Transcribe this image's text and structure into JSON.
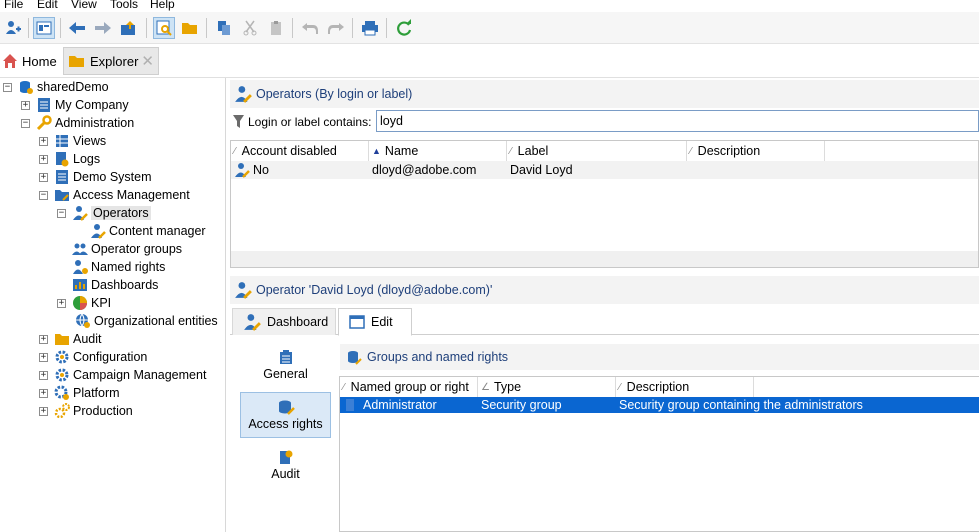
{
  "menu": [
    "File",
    "Edit",
    "View",
    "Tools",
    "Help"
  ],
  "tabs": {
    "home": "Home",
    "explorer": "Explorer"
  },
  "tree": {
    "root": "sharedDemo",
    "my_company": "My Company",
    "administration": "Administration",
    "views": "Views",
    "logs": "Logs",
    "demo_system": "Demo System",
    "access_management": "Access Management",
    "operators": "Operators",
    "content_manager": "Content manager",
    "operator_groups": "Operator groups",
    "named_rights": "Named rights",
    "dashboards": "Dashboards",
    "kpi": "KPI",
    "organizational_entities": "Organizational entities",
    "audit": "Audit",
    "configuration": "Configuration",
    "campaign_management": "Campaign Management",
    "platform": "Platform",
    "production": "Production"
  },
  "operators_panel": {
    "title": "Operators (By login or label)",
    "filter_label": "Login or label contains:",
    "filter_value": "loyd",
    "columns": [
      "Account disabled",
      "Name",
      "Label",
      "Description"
    ],
    "rows": [
      {
        "account_disabled": "No",
        "name": "dloyd@adobe.com",
        "label": "David Loyd",
        "description": ""
      }
    ]
  },
  "detail_panel": {
    "title": "Operator 'David Loyd (dloyd@adobe.com)'",
    "subtabs": {
      "dashboard": "Dashboard",
      "edit": "Edit"
    },
    "nav": {
      "general": "General",
      "access_rights": "Access rights",
      "audit": "Audit"
    },
    "groups_title": "Groups and named rights",
    "group_columns": [
      "Named group or right",
      "Type",
      "Description"
    ],
    "group_rows": [
      {
        "name": "Administrator",
        "type": "Security group",
        "description": "Security group containing the administrators"
      }
    ]
  },
  "colors": {
    "selection": "#0a66d1",
    "header_text": "#1e3f7a",
    "accent_blue": "#1f6fc5",
    "accent_orange": "#e8a400",
    "refresh_green": "#2e9e3a"
  }
}
